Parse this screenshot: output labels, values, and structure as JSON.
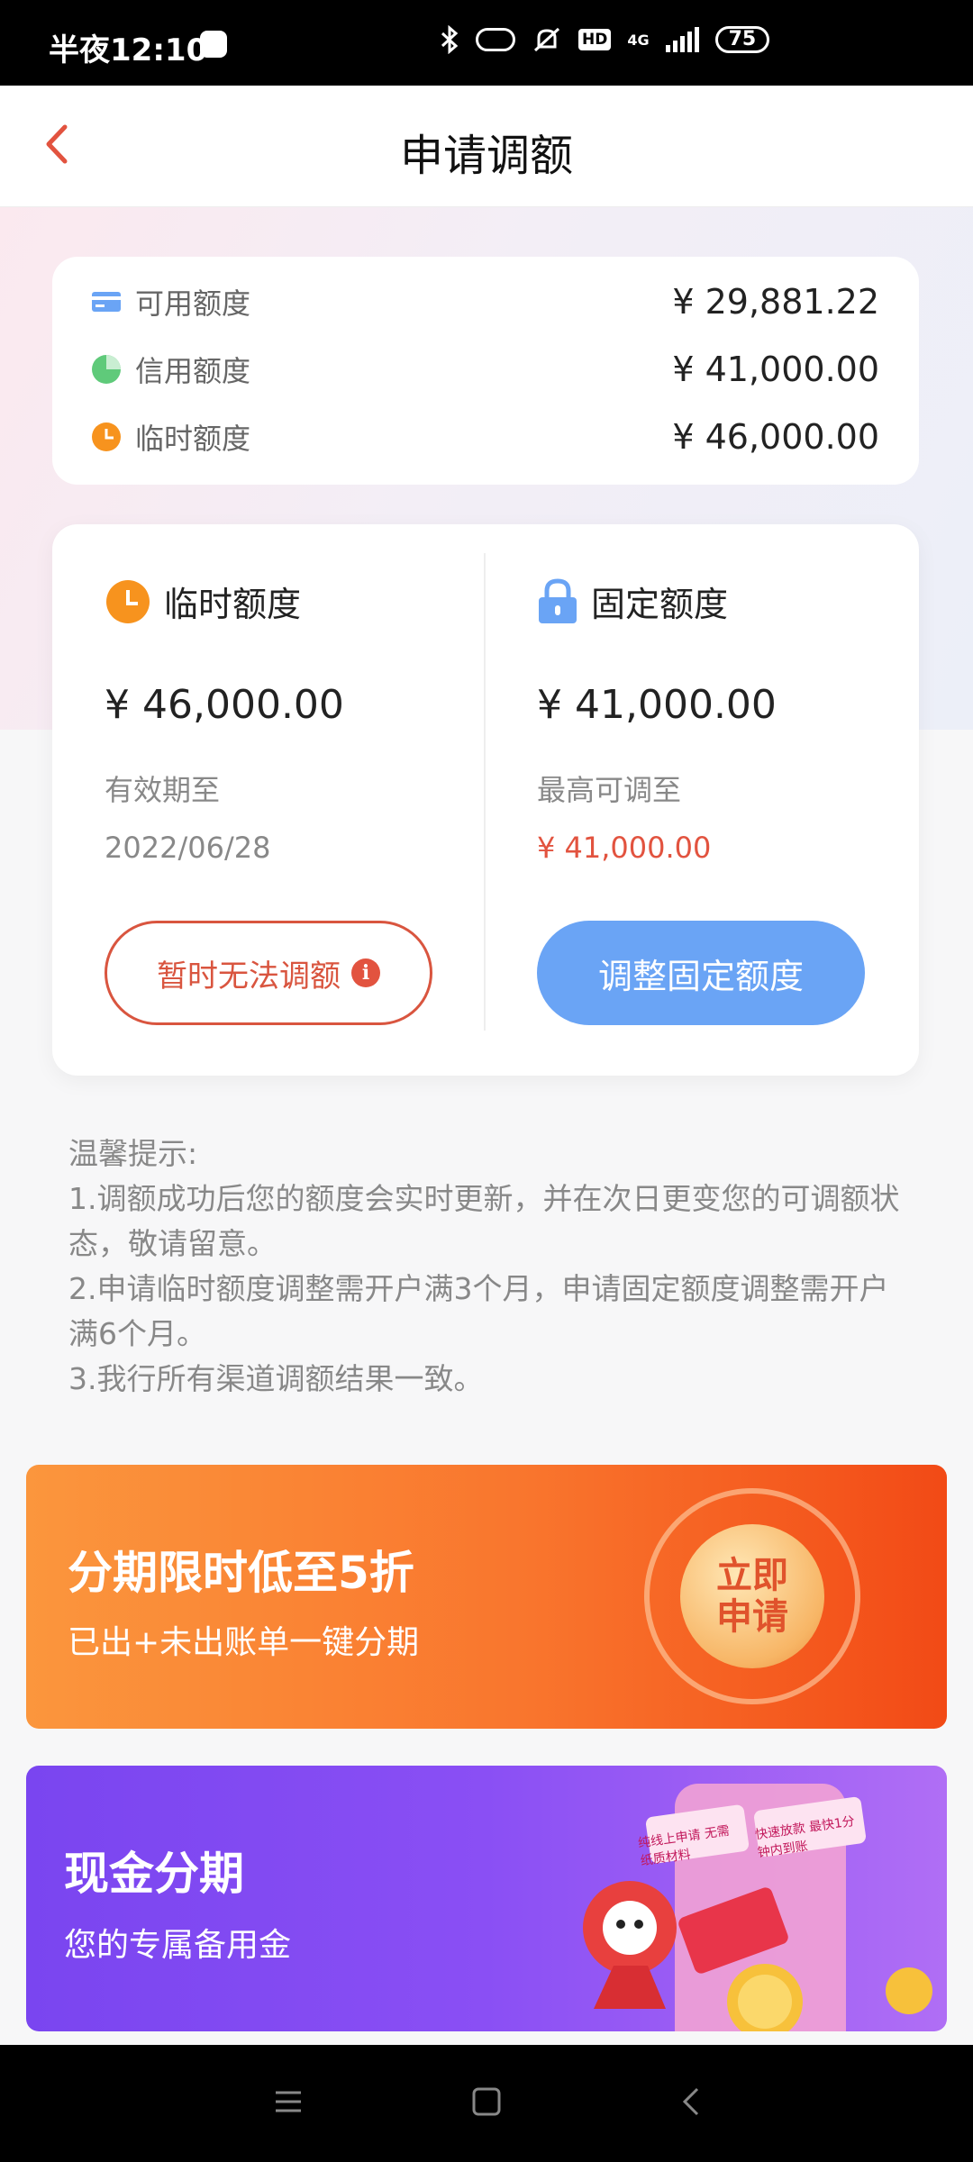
{
  "status_bar": {
    "time": "半夜12:10",
    "network": "4G",
    "hd": "HD",
    "battery": "75"
  },
  "header": {
    "title": "申请调额"
  },
  "summary": {
    "rows": [
      {
        "label": "可用额度",
        "value": "¥ 29,881.22",
        "icon": "card-icon"
      },
      {
        "label": "信用额度",
        "value": "¥ 41,000.00",
        "icon": "pie-chart-icon"
      },
      {
        "label": "临时额度",
        "value": "¥ 46,000.00",
        "icon": "clock-icon"
      }
    ]
  },
  "temporary": {
    "title": "临时额度",
    "amount": "¥ 46,000.00",
    "expiry_label": "有效期至",
    "expiry_date": "2022/06/28",
    "button_label": "暂时无法调额"
  },
  "fixed": {
    "title": "固定额度",
    "amount": "¥ 41,000.00",
    "max_label": "最高可调至",
    "max_value": "¥ 41,000.00",
    "button_label": "调整固定额度"
  },
  "tips": {
    "heading": "温馨提示:",
    "items": [
      "1.调额成功后您的额度会实时更新，并在次日更变您的可调额状态，敬请留意。",
      "2.申请临时额度调整需开户满3个月，申请固定额度调整需开户满6个月。",
      "3.我行所有渠道调额结果一致。"
    ]
  },
  "banners": {
    "installment": {
      "title": "分期限时低至5折",
      "subtitle": "已出+未出账单一键分期",
      "badge": "立即申请"
    },
    "cash": {
      "title": "现金分期",
      "subtitle": "您的专属备用金",
      "tag1": "纯线上申请 无需纸质材料",
      "tag2": "快速放款 最快1分钟内到账"
    }
  },
  "colors": {
    "accent_red": "#e2533f",
    "accent_blue": "#6aa4f5",
    "orange": "#f7931e"
  }
}
